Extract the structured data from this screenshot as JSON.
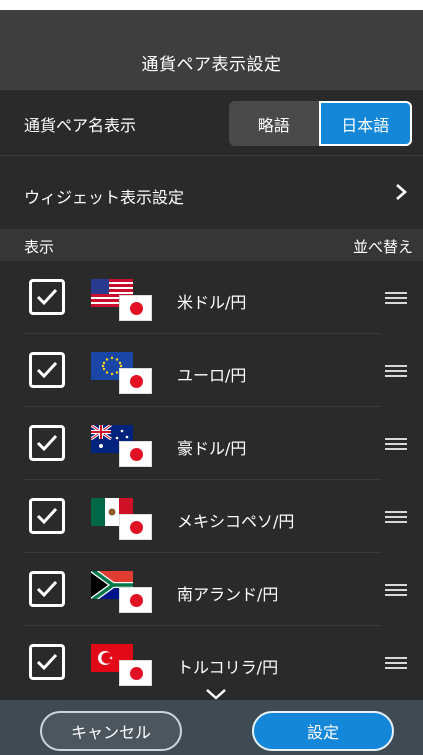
{
  "header": {
    "title": "通貨ペア表示設定"
  },
  "name_display": {
    "label": "通貨ペア名表示",
    "options": [
      "略語",
      "日本語"
    ],
    "selected": "日本語"
  },
  "widget": {
    "label": "ウィジェット表示設定"
  },
  "list_header": {
    "left": "表示",
    "right": "並べ替え"
  },
  "pairs": [
    {
      "name": "米ドル/円",
      "checked": true,
      "flag": "us-flag-icon"
    },
    {
      "name": "ユーロ/円",
      "checked": true,
      "flag": "eu-flag-icon"
    },
    {
      "name": "豪ドル/円",
      "checked": true,
      "flag": "au-flag-icon"
    },
    {
      "name": "メキシコペソ/円",
      "checked": true,
      "flag": "mx-flag-icon"
    },
    {
      "name": "南アランド/円",
      "checked": true,
      "flag": "za-flag-icon"
    },
    {
      "name": "トルコリラ/円",
      "checked": true,
      "flag": "tr-flag-icon"
    }
  ],
  "footer": {
    "cancel_label": "キャンセル",
    "set_label": "設定"
  },
  "colors": {
    "accent": "#1487d8",
    "background": "#2a2a2a",
    "header": "#3e3e3e",
    "footer": "#3f4a52"
  }
}
